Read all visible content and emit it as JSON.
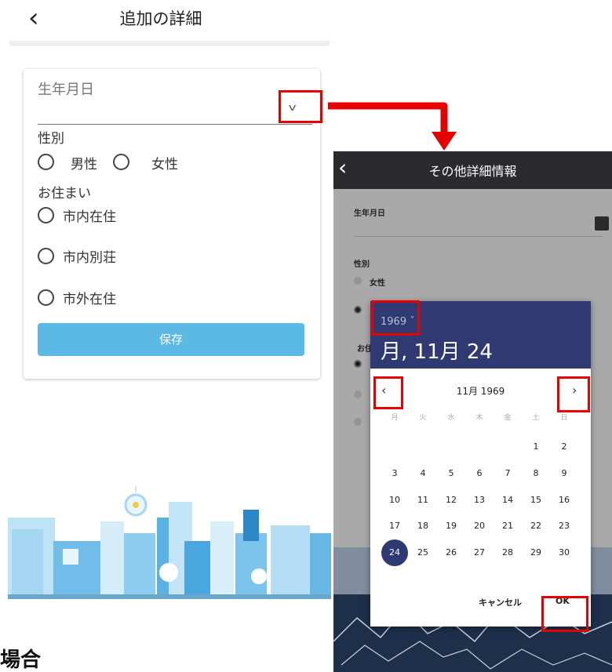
{
  "left": {
    "back_icon": "chevron-left-icon",
    "title": "追加の詳細",
    "birth_label": "生年月日",
    "gender_label": "性別",
    "gender_options": [
      "男性",
      "女性"
    ],
    "residence_label": "お住まい",
    "residence_options": [
      "市内在住",
      "市内別荘",
      "市外在住"
    ],
    "save_label": "保存",
    "accent_color": "#5cb8e4"
  },
  "right": {
    "back_icon": "chevron-left-icon",
    "title": "その他詳細情報",
    "birth_label": "生年月日",
    "gender_label": "性別",
    "gender_option": "女性",
    "residence_label_partial": "お住",
    "calendar_icon": "calendar-icon"
  },
  "picker": {
    "year": "1969",
    "selected_date": "月, 11月 24",
    "month_label": "11月 1969",
    "weekdays": [
      "月",
      "火",
      "水",
      "木",
      "金",
      "土",
      "日"
    ],
    "weeks": [
      [
        "",
        "",
        "",
        "",
        "",
        "1",
        "2"
      ],
      [
        "3",
        "4",
        "5",
        "6",
        "7",
        "8",
        "9"
      ],
      [
        "10",
        "11",
        "12",
        "13",
        "14",
        "15",
        "16"
      ],
      [
        "17",
        "18",
        "19",
        "20",
        "21",
        "22",
        "23"
      ],
      [
        "24",
        "25",
        "26",
        "27",
        "28",
        "29",
        "30"
      ]
    ],
    "selected_day": "24",
    "cancel_label": "キャンセル",
    "ok_label": "OK",
    "header_color": "#2f3972"
  },
  "annotation": {
    "highlight_color": "#e60000",
    "caption_partial": "場合"
  }
}
